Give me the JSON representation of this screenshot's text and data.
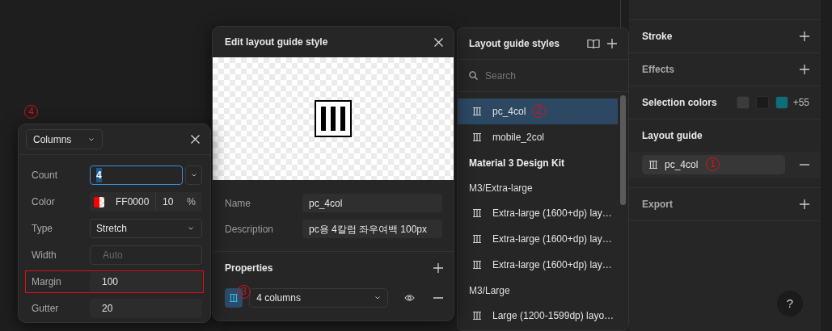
{
  "inspector": {
    "sections": [
      {
        "kind": "add",
        "title": "Stroke",
        "dim": false
      },
      {
        "kind": "add",
        "title": "Effects",
        "dim": true
      },
      {
        "kind": "colors",
        "title": "Selection colors",
        "swatches": [
          {
            "color": "#3c3c3c"
          },
          {
            "color": "#1b1b1b"
          },
          {
            "color": "#0b6e7a"
          }
        ],
        "more": "+55"
      },
      {
        "kind": "guides",
        "title": "Layout guide",
        "items": [
          {
            "name": "pc_4col",
            "annotation": "1"
          }
        ]
      },
      {
        "kind": "add",
        "title": "Export",
        "dim": true
      }
    ],
    "help": "?"
  },
  "columns_popup": {
    "annotation": "4",
    "type_select": "Columns",
    "rows": [
      {
        "kind": "combo",
        "label": "Count",
        "value": "4",
        "focused": true,
        "highlighted": false
      },
      {
        "kind": "color",
        "label": "Color",
        "hex": "FF0000",
        "opacity": "10",
        "unit": "%",
        "highlighted": false
      },
      {
        "kind": "select",
        "label": "Type",
        "value": "Stretch",
        "highlighted": false
      },
      {
        "kind": "input",
        "label": "Width",
        "placeholder": "Auto",
        "highlighted": false
      },
      {
        "kind": "input",
        "label": "Margin",
        "value": "100",
        "highlighted": true
      },
      {
        "kind": "input",
        "label": "Gutter",
        "value": "20",
        "highlighted": false
      }
    ]
  },
  "editor": {
    "title": "Edit layout guide style",
    "fields": [
      {
        "label": "Name",
        "value": "pc_4col"
      },
      {
        "label": "Description",
        "value": "pc용 4칼럼 좌우여백 100px"
      }
    ],
    "properties_title": "Properties",
    "property": {
      "value": "4 columns",
      "selected": true,
      "annotation": "3"
    }
  },
  "styles_panel": {
    "title": "Layout guide styles",
    "search_placeholder": "Search",
    "items": [
      {
        "kind": "style",
        "label": "pc_4col",
        "selected": true,
        "annotation": "2"
      },
      {
        "kind": "style",
        "label": "mobile_2col",
        "selected": false
      },
      {
        "kind": "library",
        "label": "Material 3 Design Kit"
      },
      {
        "kind": "group",
        "label": "M3/Extra-large"
      },
      {
        "kind": "style",
        "label": "Extra-large (1600+dp) lay…",
        "selected": false
      },
      {
        "kind": "style",
        "label": "Extra-large (1600+dp) lay…",
        "selected": false
      },
      {
        "kind": "style",
        "label": "Extra-large (1600+dp) lay…",
        "selected": false
      },
      {
        "kind": "group",
        "label": "M3/Large"
      },
      {
        "kind": "style",
        "label": "Large (1200-1599dp) layo…",
        "selected": false
      }
    ]
  }
}
